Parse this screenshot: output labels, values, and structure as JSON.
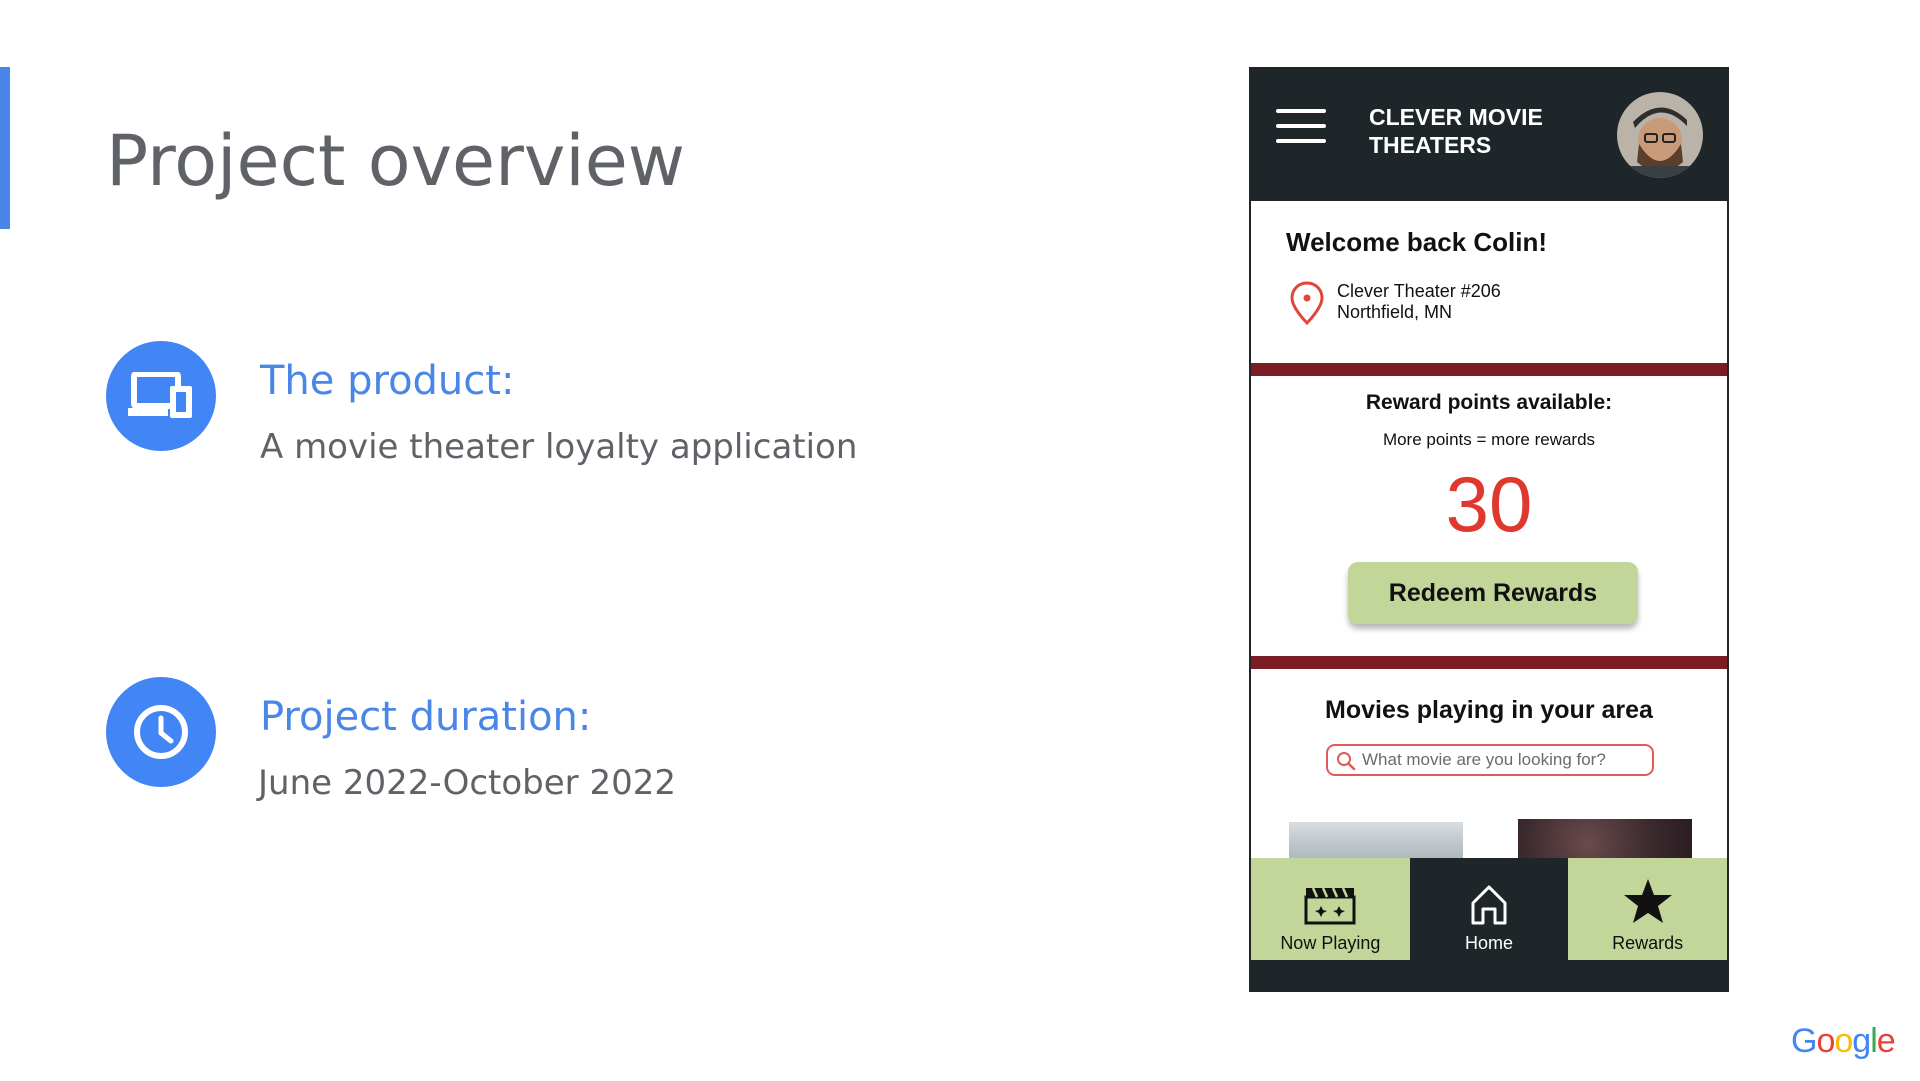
{
  "slide": {
    "title": "Project overview",
    "product_label": "The product:",
    "product_desc": "A movie theater loyalty application",
    "duration_label": "Project duration:",
    "duration_desc": "June 2022-October 2022",
    "accent_color": "#4a86e8",
    "icons": [
      "devices-icon",
      "clock-icon"
    ]
  },
  "app": {
    "title_line1": "CLEVER MOVIE",
    "title_line2": "THEATERS",
    "welcome": "Welcome back Colin!",
    "theater_name": "Clever Theater #206",
    "theater_city": "Northfield, MN",
    "reward_title": "Reward points available:",
    "reward_subtitle": "More points = more rewards",
    "points": "30",
    "redeem_label": "Redeem Rewards",
    "movies_title": "Movies playing in your area",
    "search_placeholder": "What movie are you looking for?",
    "nav": {
      "now_playing": "Now Playing",
      "home": "Home",
      "rewards": "Rewards"
    },
    "colors": {
      "header": "#1e2629",
      "divider": "#7b1d23",
      "button": "#c3d69a",
      "points": "#e0382f"
    }
  },
  "brand": {
    "letters": [
      "G",
      "o",
      "o",
      "g",
      "l",
      "e"
    ],
    "colors": [
      "#4285f4",
      "#ea4335",
      "#fbbc05",
      "#4285f4",
      "#34a853",
      "#ea4335"
    ]
  }
}
